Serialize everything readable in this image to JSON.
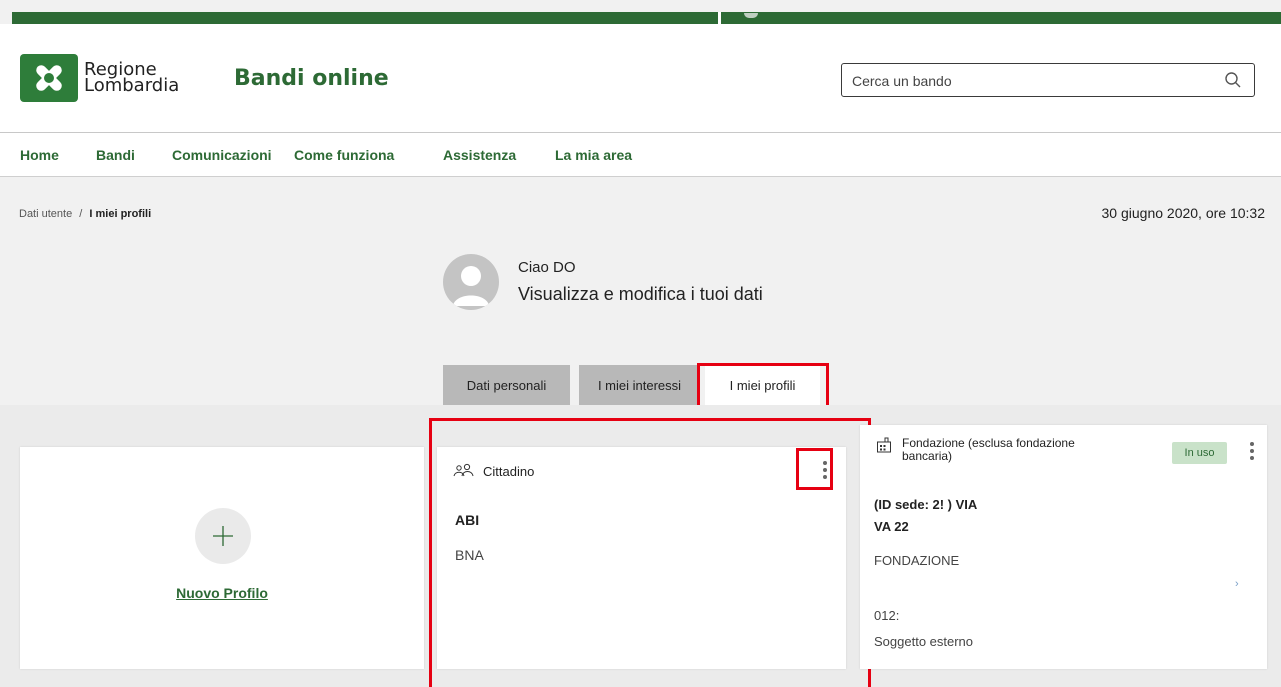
{
  "header": {
    "brand_line1": "Regione",
    "brand_line2": "Lombardia",
    "site_title": "Bandi online",
    "search_placeholder": "Cerca un bando",
    "search_icon": "search-icon",
    "logo_icon": "regione-lombardia-logo-icon"
  },
  "nav": {
    "items": [
      {
        "label": "Home"
      },
      {
        "label": "Bandi"
      },
      {
        "label": "Comunicazioni"
      },
      {
        "label": "Come funziona"
      },
      {
        "label": "Assistenza"
      },
      {
        "label": "La mia area"
      }
    ]
  },
  "breadcrumb": {
    "parent": "Dati utente",
    "separator": "/",
    "current": "I miei profili"
  },
  "datetime": "30 giugno 2020, ore 10:32",
  "user": {
    "greeting": "Ciao DO",
    "subtitle": "Visualizza e modifica i tuoi dati",
    "avatar_icon": "user-avatar-icon"
  },
  "tabs": [
    {
      "label": "Dati personali",
      "active": false
    },
    {
      "label": "I miei interessi",
      "active": false
    },
    {
      "label": "I miei profili",
      "active": true
    }
  ],
  "cards": {
    "new_profile": {
      "label": "Nuovo Profilo",
      "icon": "plus-icon"
    },
    "cittadino": {
      "type": "Cittadino",
      "icon": "people-icon",
      "name": "ABI",
      "code": "BNA"
    },
    "fondazione": {
      "type": "Fondazione (esclusa fondazione bancaria)",
      "icon": "building-icon",
      "badge": "In uso",
      "line1": "(ID sede: 2! ) VIA",
      "line2": "VA 22",
      "line3": "FONDAZIONE",
      "line4": "012:",
      "line5": "Soggetto esterno"
    }
  },
  "colors": {
    "brand_green": "#2d6a35",
    "highlight_red": "#e60012",
    "badge_bg": "#c9e2c9"
  }
}
